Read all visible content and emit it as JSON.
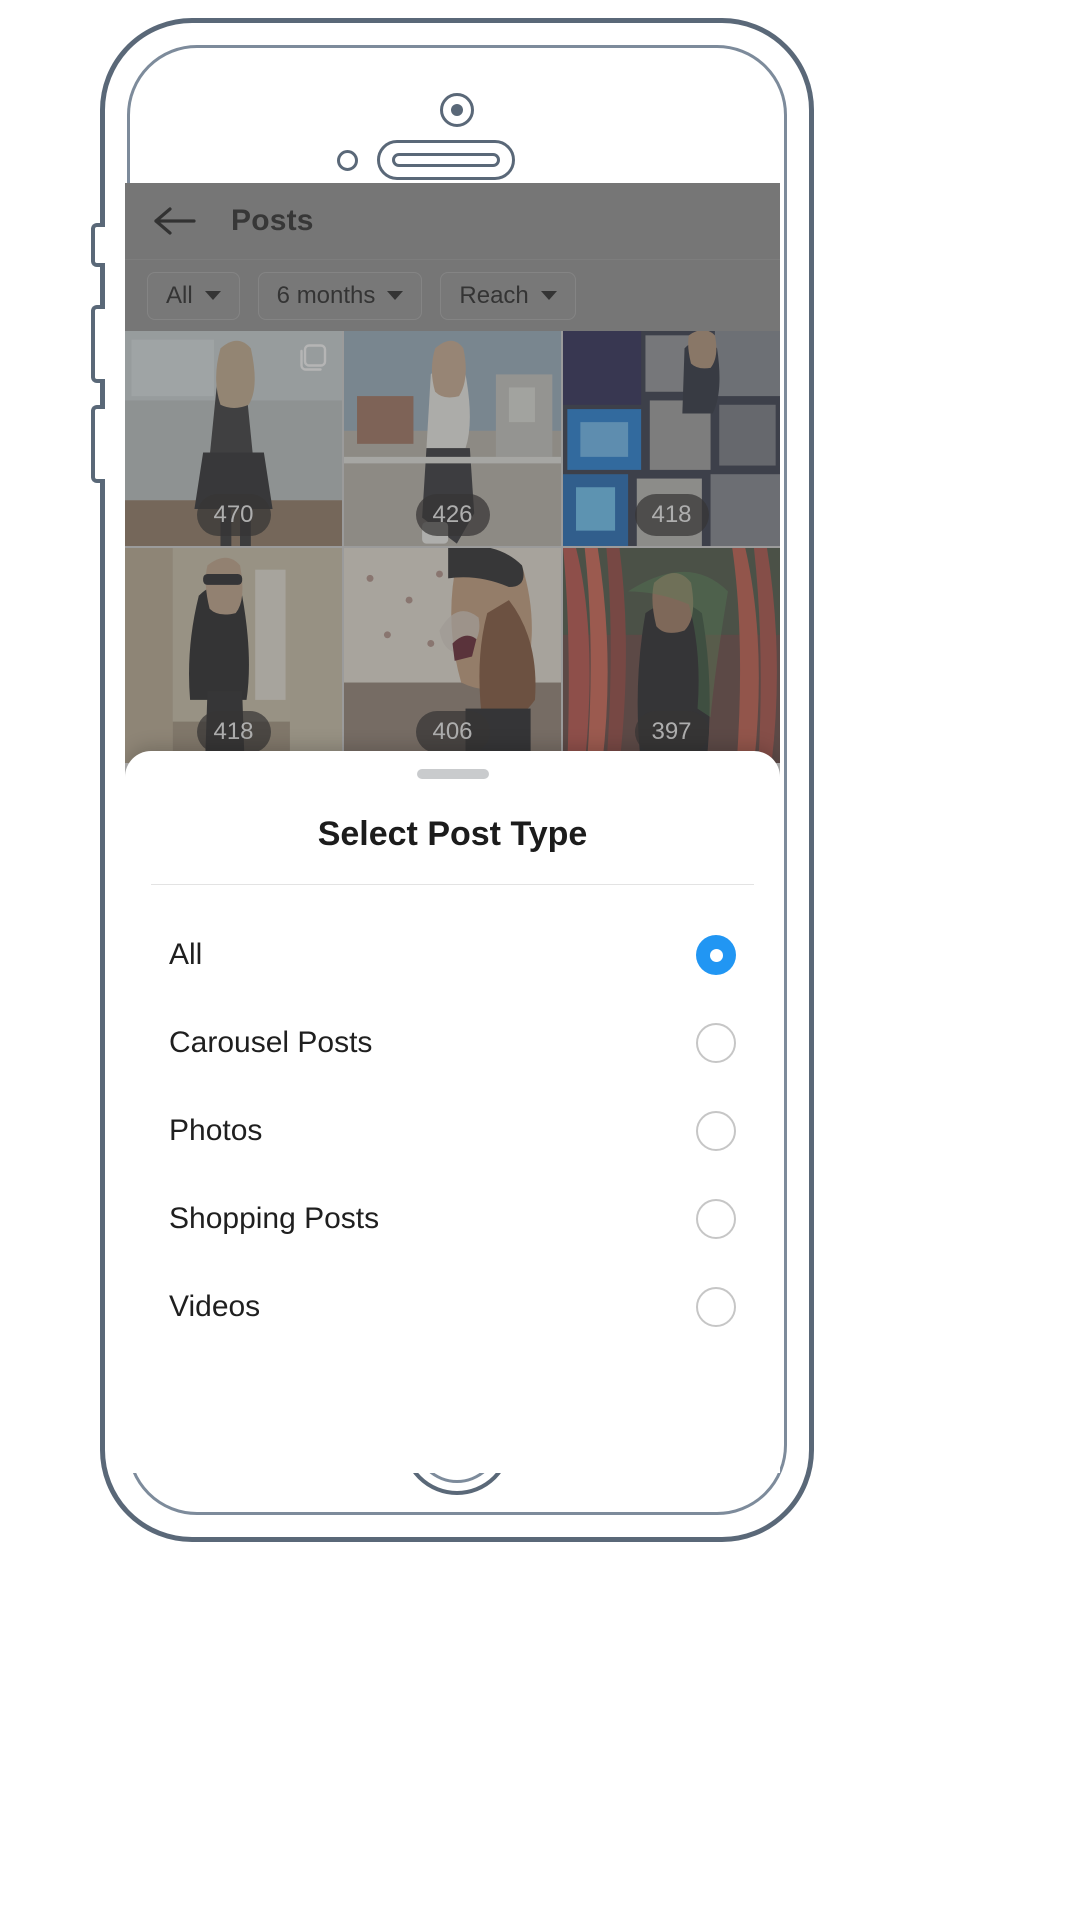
{
  "app": {
    "header": {
      "back_icon": "arrow-left-icon",
      "title": "Posts"
    },
    "filters": [
      {
        "label": "All",
        "icon": "chevron-down-icon"
      },
      {
        "label": "6 months",
        "icon": "chevron-down-icon"
      },
      {
        "label": "Reach",
        "icon": "chevron-down-icon"
      }
    ],
    "grid": {
      "metric": "Reach",
      "posts": [
        {
          "value": "470",
          "type": "carousel",
          "type_icon": "carousel-icon",
          "alt": "Woman in black blouse and skirt standing in an office"
        },
        {
          "value": "426",
          "type": "photo",
          "type_icon": "",
          "alt": "Woman in white coat posing on a rooftop"
        },
        {
          "value": "418",
          "type": "photo",
          "type_icon": "",
          "alt": "Woman in front of a wall of glowing TV screens"
        },
        {
          "value": "418",
          "type": "photo",
          "type_icon": "",
          "alt": "Woman in black coat in a narrow alley"
        },
        {
          "value": "406",
          "type": "photo",
          "type_icon": "",
          "alt": "Woman in black hat drinking red wine"
        },
        {
          "value": "397",
          "type": "photo",
          "type_icon": "",
          "alt": "Woman against a colorful graffiti wall"
        }
      ]
    }
  },
  "sheet": {
    "handle": "drag-handle",
    "title": "Select Post Type",
    "options": [
      {
        "label": "All",
        "selected": true
      },
      {
        "label": "Carousel Posts",
        "selected": false
      },
      {
        "label": "Photos",
        "selected": false
      },
      {
        "label": "Shopping Posts",
        "selected": false
      },
      {
        "label": "Videos",
        "selected": false
      }
    ]
  },
  "device": {
    "camera_icon": "front-camera-icon",
    "sensor_icon": "proximity-sensor-icon",
    "speaker_icon": "earpiece-speaker-icon",
    "home_button_icon": "home-button-icon"
  },
  "colors": {
    "accent": "#2196f3",
    "radio_outline": "#c6c6c6",
    "overlay": "#5a5a5a",
    "appbar": "#8d8d8d",
    "frame": "#5a6878"
  }
}
